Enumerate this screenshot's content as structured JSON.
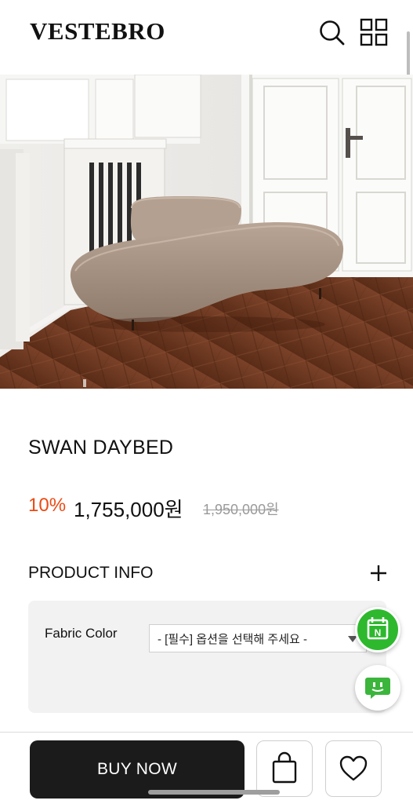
{
  "header": {
    "brand": "VESTEBRO",
    "search_icon": "search-icon",
    "menu_icon": "grid-menu-icon"
  },
  "hero": {
    "image": "sofa-product-photo"
  },
  "product": {
    "title": "SWAN DAYBED",
    "discount": "10%",
    "price": "1,755,000원",
    "original_price": "1,950,000원"
  },
  "info": {
    "label": "PRODUCT INFO",
    "expand_icon": "plus-icon"
  },
  "options": {
    "fabric_label": "Fabric Color",
    "fabric_value": "- [필수] 옵션을 선택해 주세요 -"
  },
  "floating": {
    "calendar_icon": "naver-calendar-icon",
    "chat_icon": "chat-icon"
  },
  "bottom": {
    "buy_label": "BUY NOW",
    "cart_icon": "shopping-bag-icon",
    "wish_icon": "heart-icon"
  },
  "colors": {
    "discount": "#ec4a12",
    "buy_button": "#1b1b1b",
    "fab_green": "#2eb82e"
  }
}
